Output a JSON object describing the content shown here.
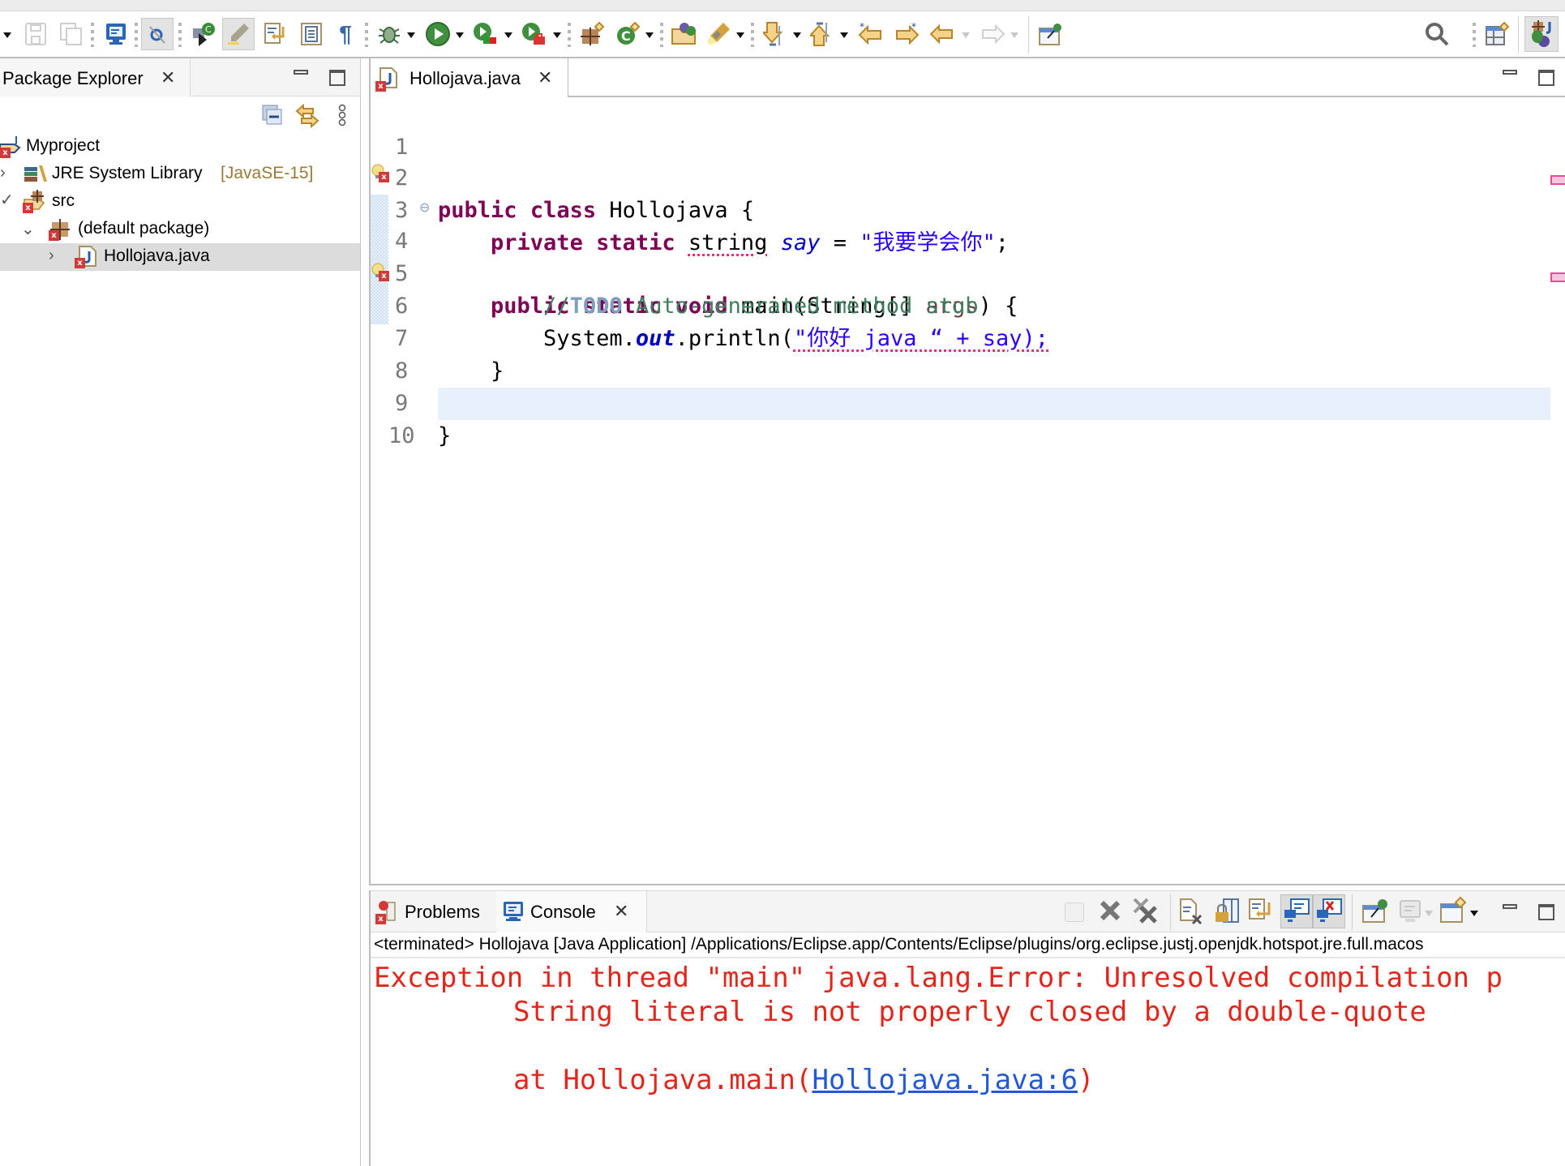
{
  "toolbar": {
    "left_icons": [
      "dropdown-arrow",
      "save-icon",
      "save-all-icon",
      "console-view-icon",
      "mark-occurrences-icon",
      "new-class-icon",
      "highlight-icon",
      "word-wrap-icon",
      "block-selection-icon",
      "pilcrow-icon",
      "debug-icon",
      "run-icon",
      "coverage-icon",
      "external-tools-icon",
      "new-package-icon",
      "new-class-wizard-icon",
      "open-type-icon",
      "search-flashlight-icon",
      "next-annotation-icon",
      "previous-annotation-icon",
      "last-edit-location-icon",
      "forward-edit-icon",
      "back-icon",
      "forward-icon",
      "pin-editor-icon"
    ],
    "pilcrow_glyph": "¶",
    "right_icons": [
      "search-icon",
      "open-perspective-icon",
      "java-perspective-icon"
    ]
  },
  "package_explorer": {
    "title": "Package Explorer",
    "close_glyph": "✕",
    "tree": [
      {
        "label": "Myproject",
        "suffix": "",
        "chevron": "",
        "icon": "java-project-icon",
        "error": true
      },
      {
        "label": "JRE System Library",
        "suffix": "[JavaSE-15]",
        "chevron": "›",
        "icon": "library-icon",
        "error": false
      },
      {
        "label": "src",
        "suffix": "",
        "chevron": "⌄",
        "icon": "source-folder-icon",
        "error": true
      },
      {
        "label": "(default package)",
        "suffix": "",
        "chevron": "⌄",
        "icon": "package-icon",
        "error": true
      },
      {
        "label": "Hollojava.java",
        "suffix": "",
        "chevron": "›",
        "icon": "java-file-icon",
        "error": true,
        "selected": true
      }
    ]
  },
  "editor": {
    "tab_label": "Hollojava.java",
    "close_glyph": "✕",
    "line_numbers": [
      "1",
      "2",
      "3",
      "4",
      "5",
      "6",
      "7",
      "8",
      "9",
      "10"
    ],
    "lines": {
      "l2": {
        "kw1": "public",
        "kw2": "class",
        "rest": "Hollojava {"
      },
      "l3": {
        "kw1": "private",
        "kw2": "static",
        "type": "string",
        "field": "say",
        "eq": " = ",
        "str": "\"我要学会你\"",
        "end": ";"
      },
      "l4": {
        "kw1": "public",
        "kw2": "static",
        "kw3": "void",
        "m": "main(String[] ",
        "param": "args",
        "end": ") {"
      },
      "l5": {
        "c1": "//",
        "todo": "TODO",
        "c2": " Auto-generated method stub"
      },
      "l6": {
        "a": "System.",
        "out": "out",
        "b": ".println(",
        "str": "\"你好 java “ + say);"
      },
      "l7": {
        "text": "}"
      },
      "l9": {
        "text": "}"
      }
    },
    "fold_glyph": "⊖"
  },
  "bottom_panel": {
    "tabs": [
      {
        "label": "Problems",
        "icon": "problems-icon"
      },
      {
        "label": "Console",
        "icon": "console-icon",
        "active": true
      }
    ],
    "close_glyph": "✕",
    "toolbar_icons": [
      "terminate-icon",
      "remove-launch-icon",
      "remove-all-terminated-icon",
      "clear-console-icon",
      "scroll-lock-icon",
      "word-wrap-icon",
      "show-on-stdout-icon",
      "show-on-stderr-icon",
      "pin-console-icon",
      "display-console-icon",
      "open-console-icon"
    ],
    "terminated_line": "<terminated> Hollojava [Java Application] /Applications/Eclipse.app/Contents/Eclipse/plugins/org.eclipse.justj.openjdk.hotspot.jre.full.macos",
    "console": {
      "line1": "Exception in thread \"main\" java.lang.Error: Unresolved compilation p",
      "line2": "String literal is not properly closed by a double-quote",
      "line3_prefix": "at Hollojava.main(",
      "line3_link": "Hollojava.java:6",
      "line3_suffix": ")"
    }
  },
  "colors": {
    "keyword": "#7f0055",
    "string": "#2a00ff",
    "comment": "#3f7f5f",
    "error_text": "#e3261c",
    "link": "#2359d4",
    "current_line": "#e8f0fb"
  }
}
